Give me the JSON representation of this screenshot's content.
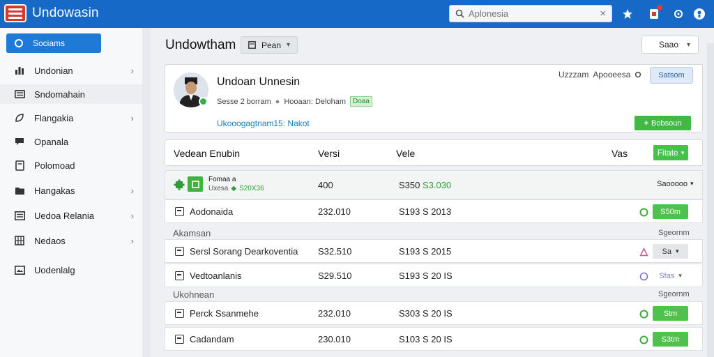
{
  "app": {
    "title": "Undowasin"
  },
  "search": {
    "placeholder": "Aplonesia",
    "clear": "×"
  },
  "sidebar": {
    "active": "Sociams",
    "items": [
      {
        "label": "Undonian",
        "icon": "bar-chart-icon",
        "chevron": "›"
      },
      {
        "label": "Sndomahain",
        "icon": "keyboard-icon",
        "chevron": ""
      },
      {
        "label": "Flangakia",
        "icon": "leaf-icon",
        "chevron": "›"
      },
      {
        "label": "Opanala",
        "icon": "chat-icon",
        "chevron": ""
      },
      {
        "label": "Polomoad",
        "icon": "document-icon",
        "chevron": ""
      },
      {
        "label": "Hangakas",
        "icon": "folder-icon",
        "chevron": "›"
      },
      {
        "label": "Uedoa Relania",
        "icon": "list-icon",
        "chevron": "›"
      },
      {
        "label": "Nedaos",
        "icon": "grid-icon",
        "chevron": "›"
      },
      {
        "label": "Uodenlalg",
        "icon": "image-icon",
        "chevron": ""
      }
    ]
  },
  "header": {
    "title": "Undowtham",
    "pill_label": "Pean",
    "select_label": "Saao"
  },
  "profile": {
    "name": "Undoan Unnesin",
    "meta_left": "Sesse 2 borram",
    "meta_right": "Hooaan: Deloham",
    "meta_badge": "Doaa",
    "link": "Ukooogagtnam15: Nakot",
    "user_label": "Uzzzam",
    "user_name": "Apooeesa",
    "action_label": "Satsom",
    "add_label": "Bobsoun"
  },
  "table": {
    "headers": [
      "Vedean Enubin",
      "Versi",
      "Vele",
      "Vas"
    ],
    "filter_label": "Fitate",
    "featured": {
      "title": "Fomaa a",
      "sub_left": "Uxesa",
      "sub_right": "S20X36",
      "version": "400",
      "value_left": "S350",
      "value_right": "S3.030",
      "select_label": "Saooooo"
    },
    "groups": [
      {
        "label": "Akamsan",
        "right": "Sgeornm"
      },
      {
        "label": "Ukohnean",
        "right": "Sgeornm"
      }
    ],
    "rows": [
      {
        "name": "Aodonaida",
        "version": "232.010",
        "value": "S193  S 2013",
        "status": "green",
        "action": "S50m",
        "style": "act-green"
      },
      {
        "name": "Sersl Sorang Dearkoventia",
        "version": "S32.510",
        "value": "S193  S 2015",
        "status": "pink",
        "action": "Sa",
        "style": "act-gray"
      },
      {
        "name": "Vedtoanlanis",
        "version": "S29.510",
        "value": "S193  S 20 IS",
        "status": "purple",
        "action": "Sfas",
        "style": "act-light"
      },
      {
        "name": "Perck Ssanmehe",
        "version": "232.010",
        "value": "S303  S 20 IS",
        "status": "green",
        "action": "Stm",
        "style": "act-green"
      },
      {
        "name": "Cadandam",
        "version": "230.010",
        "value": "S103  S 20 IS",
        "status": "green",
        "action": "S3tm",
        "style": "act-green"
      }
    ]
  },
  "colors": {
    "topbar": "#1769c8",
    "accent": "#1f7ad6",
    "success": "#43b843",
    "brand_logo": "#d63a2e"
  }
}
